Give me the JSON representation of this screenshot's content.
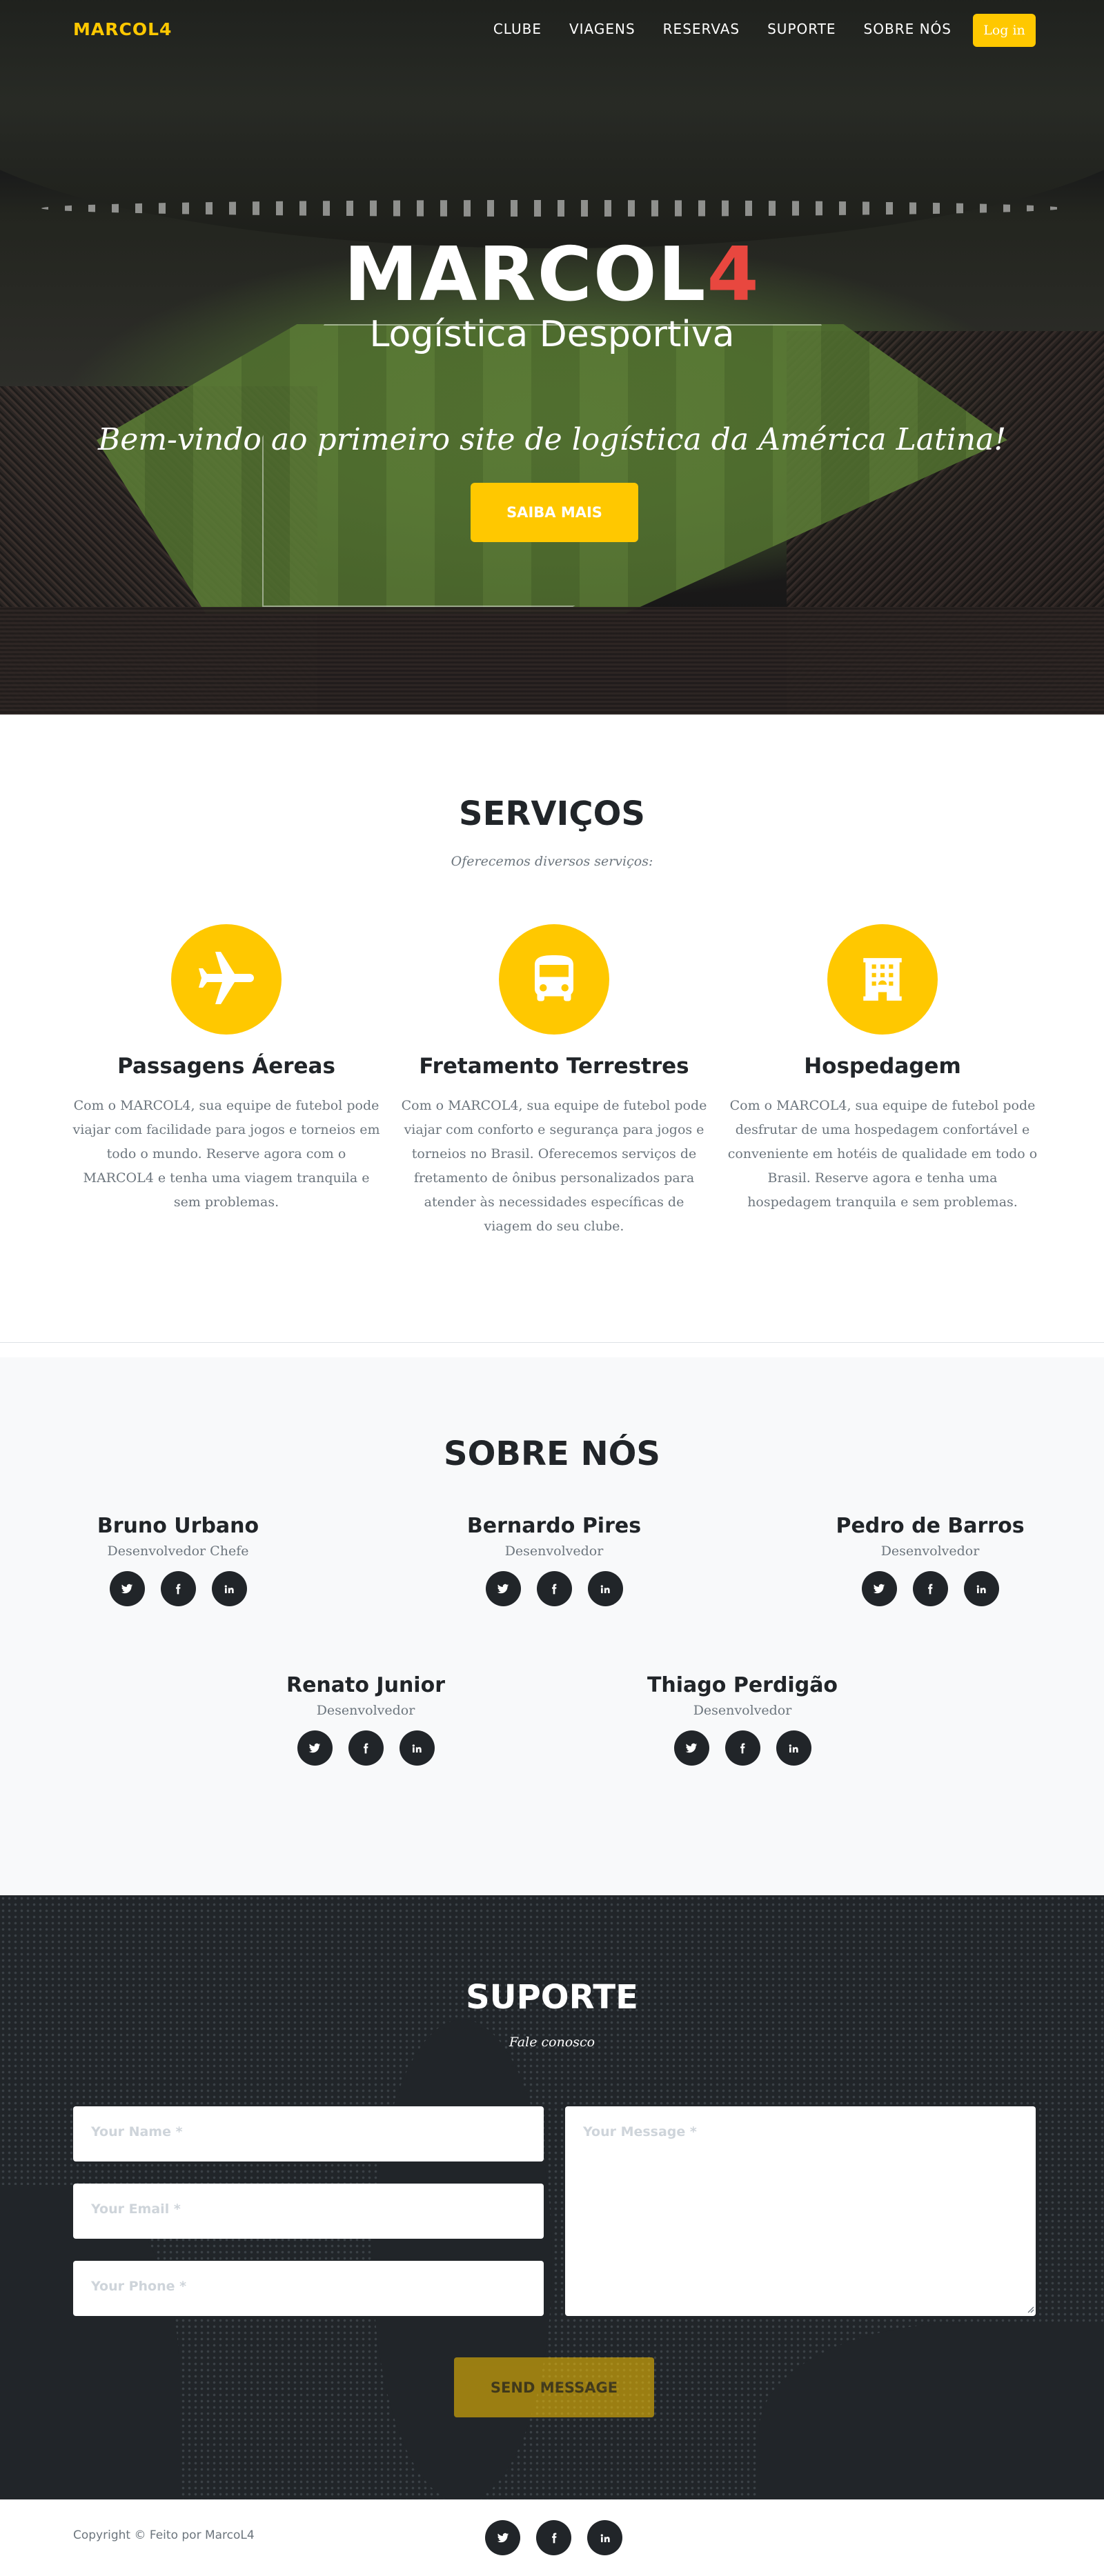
{
  "nav": {
    "brand": "MARCOL4",
    "links": [
      "CLUBE",
      "VIAGENS",
      "RESERVAS",
      "SUPORTE",
      "SOBRE NÓS"
    ],
    "login_label": "Log in"
  },
  "hero": {
    "logo_main": "MARCOL",
    "logo_accent": "4",
    "subtitle": "Logística Desportiva",
    "tagline": "Bem-vindo ao primeiro site de logística da América Latina!",
    "cta_label": "SAIBA MAIS"
  },
  "services": {
    "title": "SERVIÇOS",
    "subtitle": "Oferecemos diversos serviços:",
    "items": [
      {
        "icon": "plane-icon",
        "heading": "Passagens Áereas",
        "text": "Com o MARCOL4, sua equipe de futebol pode viajar com facilidade para jogos e torneios em todo o mundo. Reserve agora com o MARCOL4 e tenha uma viagem tranquila e sem problemas."
      },
      {
        "icon": "bus-icon",
        "heading": "Fretamento Terrestres",
        "text": "Com o MARCOL4, sua equipe de futebol pode viajar com conforto e segurança para jogos e torneios no Brasil. Oferecemos serviços de fretamento de ônibus personalizados para atender às necessidades específicas de viagem do seu clube."
      },
      {
        "icon": "hotel-icon",
        "heading": "Hospedagem",
        "text": "Com o MARCOL4, sua equipe de futebol pode desfrutar de uma hospedagem confortável e conveniente em hotéis de qualidade em todo o Brasil. Reserve agora e tenha uma hospedagem tranquila e sem problemas."
      }
    ]
  },
  "about": {
    "title": "SOBRE NÓS",
    "members": [
      {
        "name": "Bruno Urbano",
        "role": "Desenvolvedor Chefe"
      },
      {
        "name": "Bernardo Pires",
        "role": "Desenvolvedor"
      },
      {
        "name": "Pedro de Barros",
        "role": "Desenvolvedor"
      },
      {
        "name": "Renato Junior",
        "role": "Desenvolvedor"
      },
      {
        "name": "Thiago Perdigão",
        "role": "Desenvolvedor"
      }
    ],
    "social_icons": [
      "twitter-icon",
      "facebook-icon",
      "linkedin-icon"
    ]
  },
  "contact": {
    "title": "SUPORTE",
    "subtitle": "Fale conosco",
    "name_placeholder": "Your Name *",
    "email_placeholder": "Your Email *",
    "phone_placeholder": "Your Phone *",
    "message_placeholder": "Your Message *",
    "send_label": "SEND MESSAGE"
  },
  "footer": {
    "copyright": "Copyright © Feito por MarcoL4"
  },
  "colors": {
    "accent": "#ffc800",
    "logo_accent": "#e8473f",
    "dark": "#212529",
    "muted": "#6c757d"
  }
}
